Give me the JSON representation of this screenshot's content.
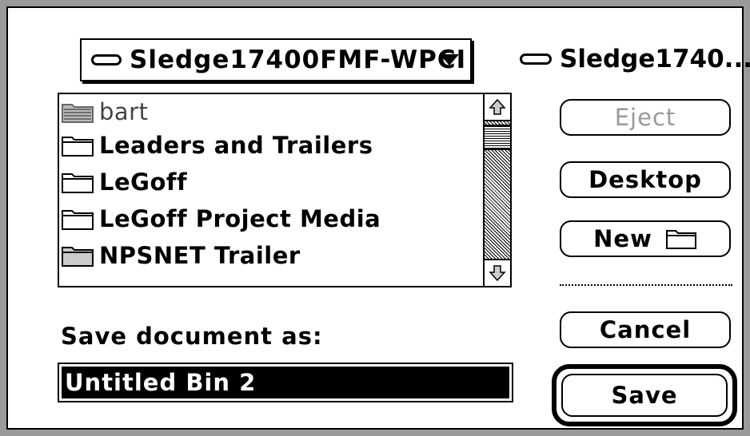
{
  "location_popup": {
    "label": "Sledge17400FMF-WPCI"
  },
  "volume": {
    "name": "Sledge1740..."
  },
  "file_list": {
    "items": [
      {
        "name": "bart",
        "icon": "server-folder-icon",
        "dimmed": true
      },
      {
        "name": "Leaders and Trailers",
        "icon": "folder-icon"
      },
      {
        "name": "LeGoff",
        "icon": "folder-icon"
      },
      {
        "name": "LeGoff Project Media",
        "icon": "folder-icon"
      },
      {
        "name": "NPSNET Trailer",
        "icon": "folder-icon"
      }
    ]
  },
  "buttons": {
    "eject": "Eject",
    "desktop": "Desktop",
    "new": "New",
    "cancel": "Cancel",
    "save": "Save"
  },
  "save_as": {
    "label": "Save document as:",
    "value": "Untitled Bin 2"
  }
}
